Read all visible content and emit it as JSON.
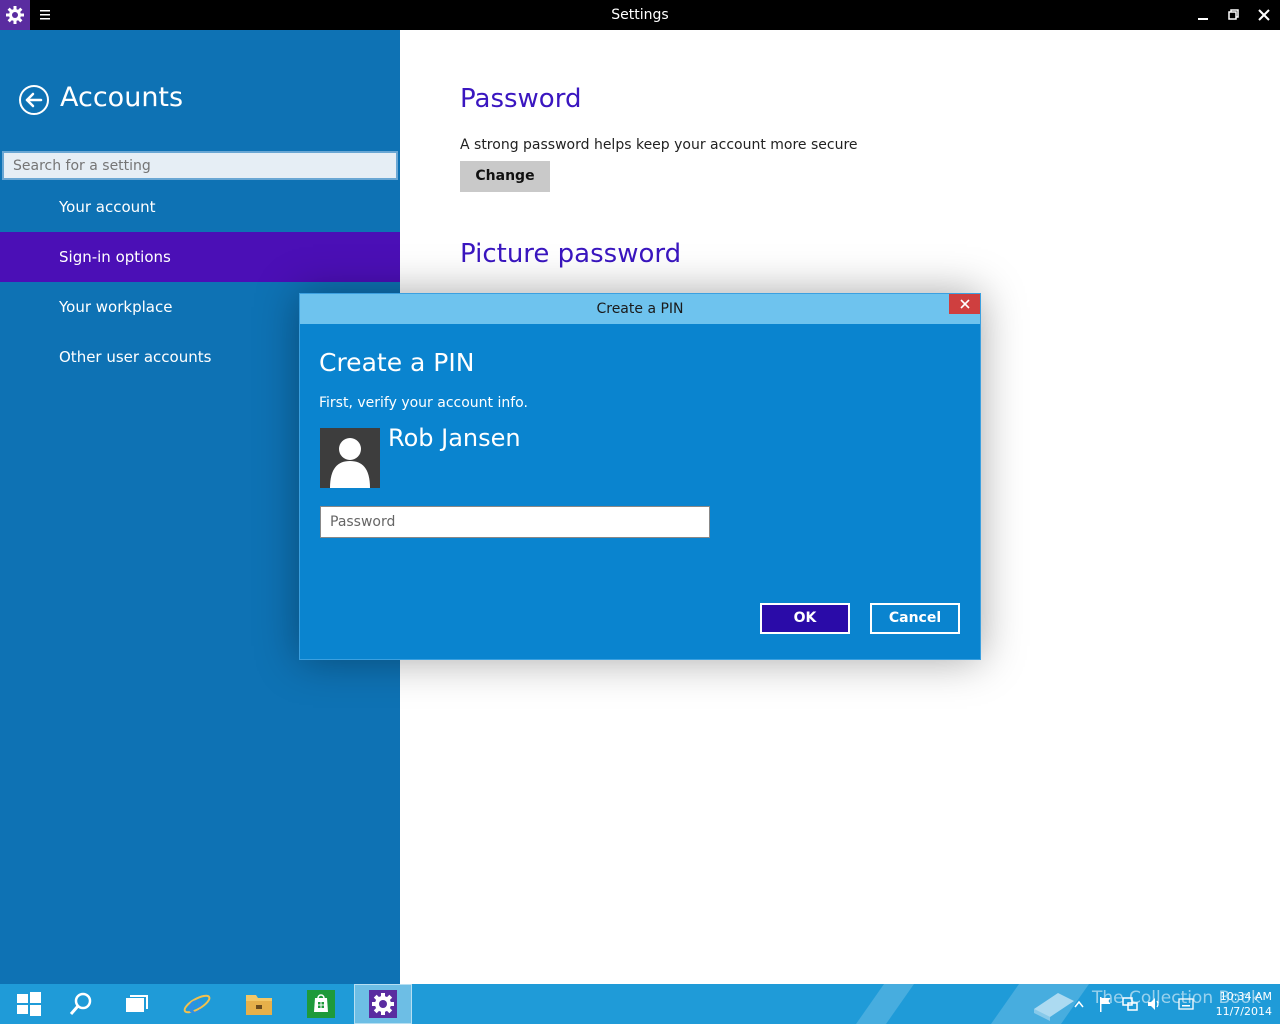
{
  "window": {
    "title": "Settings"
  },
  "nav": {
    "title": "Accounts",
    "search_placeholder": "Search for a setting",
    "items": [
      {
        "label": "Your account"
      },
      {
        "label": "Sign-in options"
      },
      {
        "label": "Your workplace"
      },
      {
        "label": "Other user accounts"
      }
    ]
  },
  "content": {
    "password_heading": "Password",
    "password_desc": "A strong password helps keep your account more secure",
    "change_label": "Change",
    "picture_password_heading": "Picture password"
  },
  "dialog": {
    "title": "Create a PIN",
    "heading": "Create a PIN",
    "subtitle": "First, verify your account info.",
    "user_name": "Rob Jansen",
    "password_placeholder": "Password",
    "ok_label": "OK",
    "cancel_label": "Cancel"
  },
  "taskbar": {
    "watermark": "The Collection Book",
    "time": "10:34 AM",
    "date": "11/7/2014"
  },
  "colors": {
    "nav_bg": "#0e72b4",
    "nav_selected": "#4b0fb6",
    "heading_purple": "#3a16c0",
    "dialog_bg": "#0a84cf",
    "taskbar_bg": "#1f9bd8"
  }
}
